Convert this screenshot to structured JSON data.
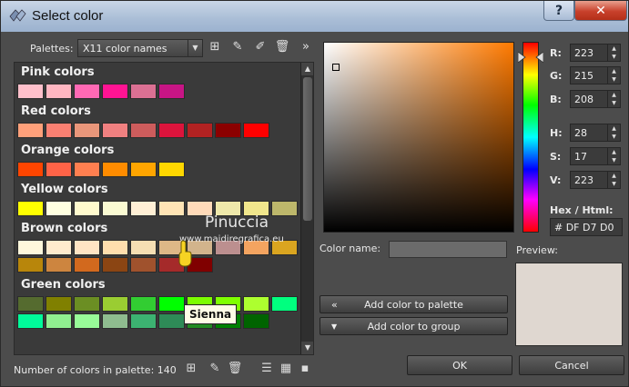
{
  "window": {
    "title": "Select color",
    "help_label": "?",
    "close_label": "✕"
  },
  "palettes": {
    "label": "Palettes:",
    "selected": "X11 color names"
  },
  "groups": [
    {
      "title": "Pink colors",
      "colors": [
        "#FFC0CB",
        "#FFB6C1",
        "#FF69B4",
        "#FF1493",
        "#DB7093",
        "#C71585"
      ]
    },
    {
      "title": "Red colors",
      "colors": [
        "#FFA07A",
        "#FA8072",
        "#E9967A",
        "#F08080",
        "#CD5C5C",
        "#DC143C",
        "#B22222",
        "#8B0000",
        "#FF0000"
      ]
    },
    {
      "title": "Orange colors",
      "colors": [
        "#FF4500",
        "#FF6347",
        "#FF7F50",
        "#FF8C00",
        "#FFA500",
        "#FFD700"
      ]
    },
    {
      "title": "Yellow colors",
      "colors": [
        "#FFFF00",
        "#FFFFE0",
        "#FFFACD",
        "#FAFAD2",
        "#FFEFD5",
        "#FFE4B5",
        "#FFDAB9",
        "#EEE8AA",
        "#F0E68C",
        "#BDB76B"
      ]
    },
    {
      "title": "Brown colors",
      "colors": [
        "#FFF8DC",
        "#FFEBCD",
        "#FFE4C4",
        "#FFDEAD",
        "#F5DEB3",
        "#DEB887",
        "#D2B48C",
        "#BC8F8F",
        "#F4A460",
        "#DAA520",
        "#B8860B",
        "#CD853F",
        "#D2691E",
        "#8B4513",
        "#A0522D",
        "#A52A2A",
        "#800000"
      ]
    },
    {
      "title": "Green colors",
      "colors": [
        "#556B2F",
        "#808000",
        "#6B8E23",
        "#9ACD32",
        "#32CD32",
        "#00FF00",
        "#7CFC00",
        "#7FFF00",
        "#ADFF2F",
        "#00FF7F",
        "#00FA9A",
        "#90EE90",
        "#98FB98",
        "#8FBC8F",
        "#3CB371",
        "#2E8B57",
        "#228B22",
        "#008000",
        "#006400"
      ]
    }
  ],
  "watermark": {
    "name": "Pinuccia",
    "url": "www.maidiregrafica.eu"
  },
  "tooltip": "Sienna",
  "footer": {
    "count_label": "Number of colors in palette: 140"
  },
  "channels": [
    {
      "label": "R:",
      "value": "223"
    },
    {
      "label": "G:",
      "value": "215"
    },
    {
      "label": "B:",
      "value": "208"
    },
    {
      "label": "H:",
      "value": "28"
    },
    {
      "label": "S:",
      "value": "17"
    },
    {
      "label": "V:",
      "value": "223"
    }
  ],
  "hex": {
    "label": "Hex / Html:",
    "value": "# DF D7 D0"
  },
  "color_name": {
    "label": "Color name:",
    "value": ""
  },
  "preview": {
    "label": "Preview:",
    "color": "#DFD7D0"
  },
  "buttons": {
    "add_palette": "Add color to palette",
    "add_group": "Add color to group",
    "ok": "OK",
    "cancel": "Cancel"
  },
  "icons": {
    "add_palette_lead": "«",
    "add_group_lead": "▼"
  }
}
